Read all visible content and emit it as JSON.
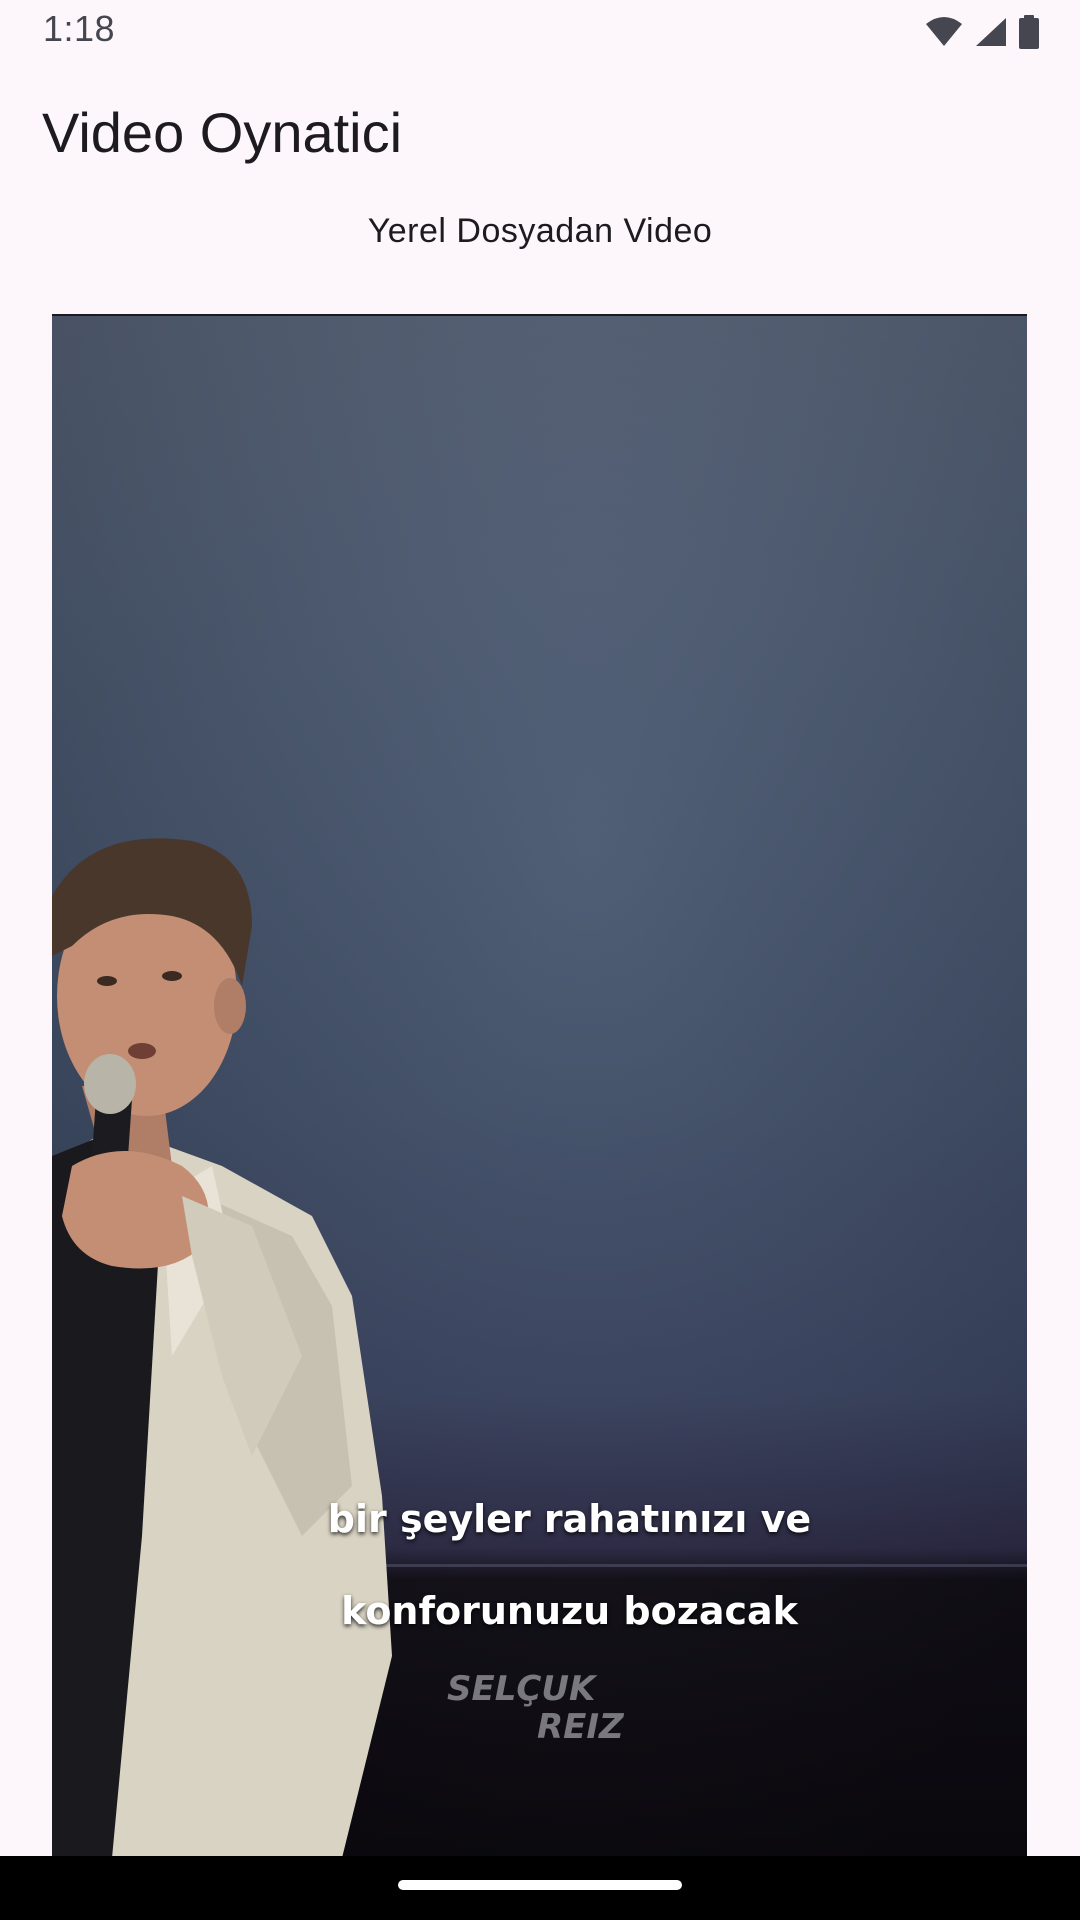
{
  "status_bar": {
    "time": "1:18",
    "icons": [
      "wifi-icon",
      "cellular-signal-icon",
      "battery-icon"
    ]
  },
  "app_bar": {
    "title": "Video Oynatici"
  },
  "section": {
    "title": "Yerel Dosyadan Video"
  },
  "video": {
    "subtitle_line1": "bir şeyler rahatınızı ve",
    "subtitle_line2": "konforunuzu bozacak",
    "watermark_text": "SELÇUK REIZ"
  },
  "colors": {
    "background": "#fdf7fb",
    "text_primary": "#1d1b20",
    "nav_bar": "#000000"
  }
}
